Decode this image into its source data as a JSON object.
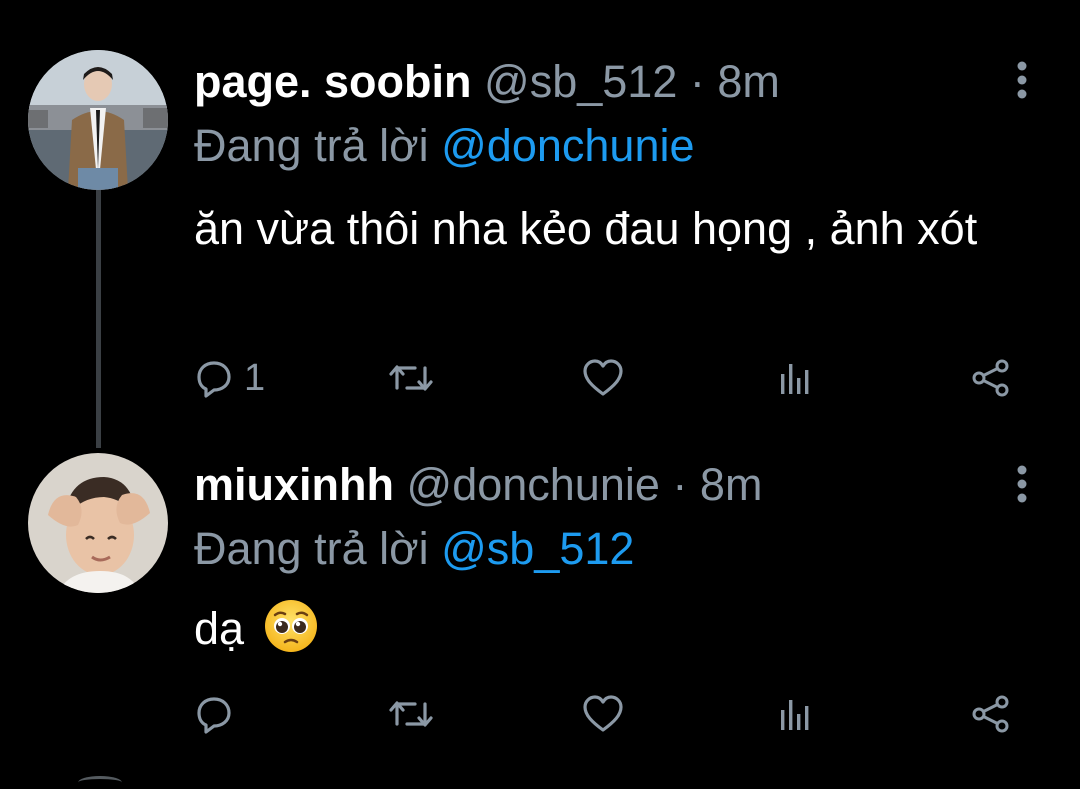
{
  "tweets": [
    {
      "display_name": "page. soobin",
      "handle": "@sb_512",
      "separator": "·",
      "time": "8m",
      "reply_prefix": "Đang trả lời",
      "reply_mention": "@donchunie",
      "text": "ăn vừa thôi nha kẻo đau họng , ảnh xót",
      "reply_count": "1",
      "avatar_icon": "avatar-person-icon",
      "avatar_colors": {
        "sky": "#b8c3cc",
        "coat": "#8a6a48"
      }
    },
    {
      "display_name": "miuxinhh",
      "handle": "@donchunie",
      "separator": "·",
      "time": "8m",
      "reply_prefix": "Đang trả lời",
      "reply_mention": "@sb_512",
      "text": "dạ",
      "emoji_icon": "pleading-face-icon",
      "reply_count": "",
      "avatar_icon": "avatar-person-icon",
      "avatar_colors": {
        "background": "#d9d4cc",
        "skin": "#e9c3a6"
      }
    }
  ],
  "colors": {
    "background": "#000000",
    "primary_text": "#ffffff",
    "secondary_text": "#8b98a5",
    "accent": "#1d9bf0",
    "thread_line": "#3a3f44"
  },
  "icons": {
    "reply": "reply-icon",
    "retweet": "retweet-icon",
    "like": "heart-icon",
    "stats": "stats-icon",
    "share": "share-icon",
    "more": "more-vertical-icon"
  }
}
